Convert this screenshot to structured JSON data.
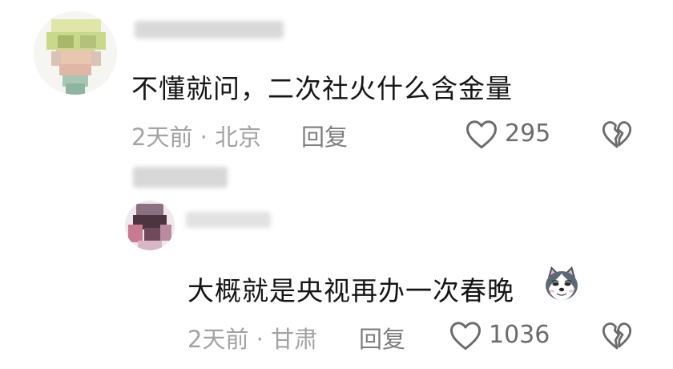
{
  "comment": {
    "text": "不懂就问，二次社火什么含金量",
    "time": "2天前",
    "separator": "·",
    "location": "北京",
    "reply_label": "回复",
    "like_count": "295"
  },
  "reply": {
    "text": "大概就是央视再办一次春晚",
    "emoji": "husky-doge-emoji",
    "time": "2天前",
    "separator": "·",
    "location": "甘肃",
    "reply_label": "回复",
    "like_count": "1036"
  },
  "icons": {
    "like": "heart-outline-icon",
    "dislike": "broken-heart-icon"
  },
  "colors": {
    "text_primary": "#161616",
    "text_meta": "#a3a3a3",
    "icon": "#6b6b6b"
  }
}
